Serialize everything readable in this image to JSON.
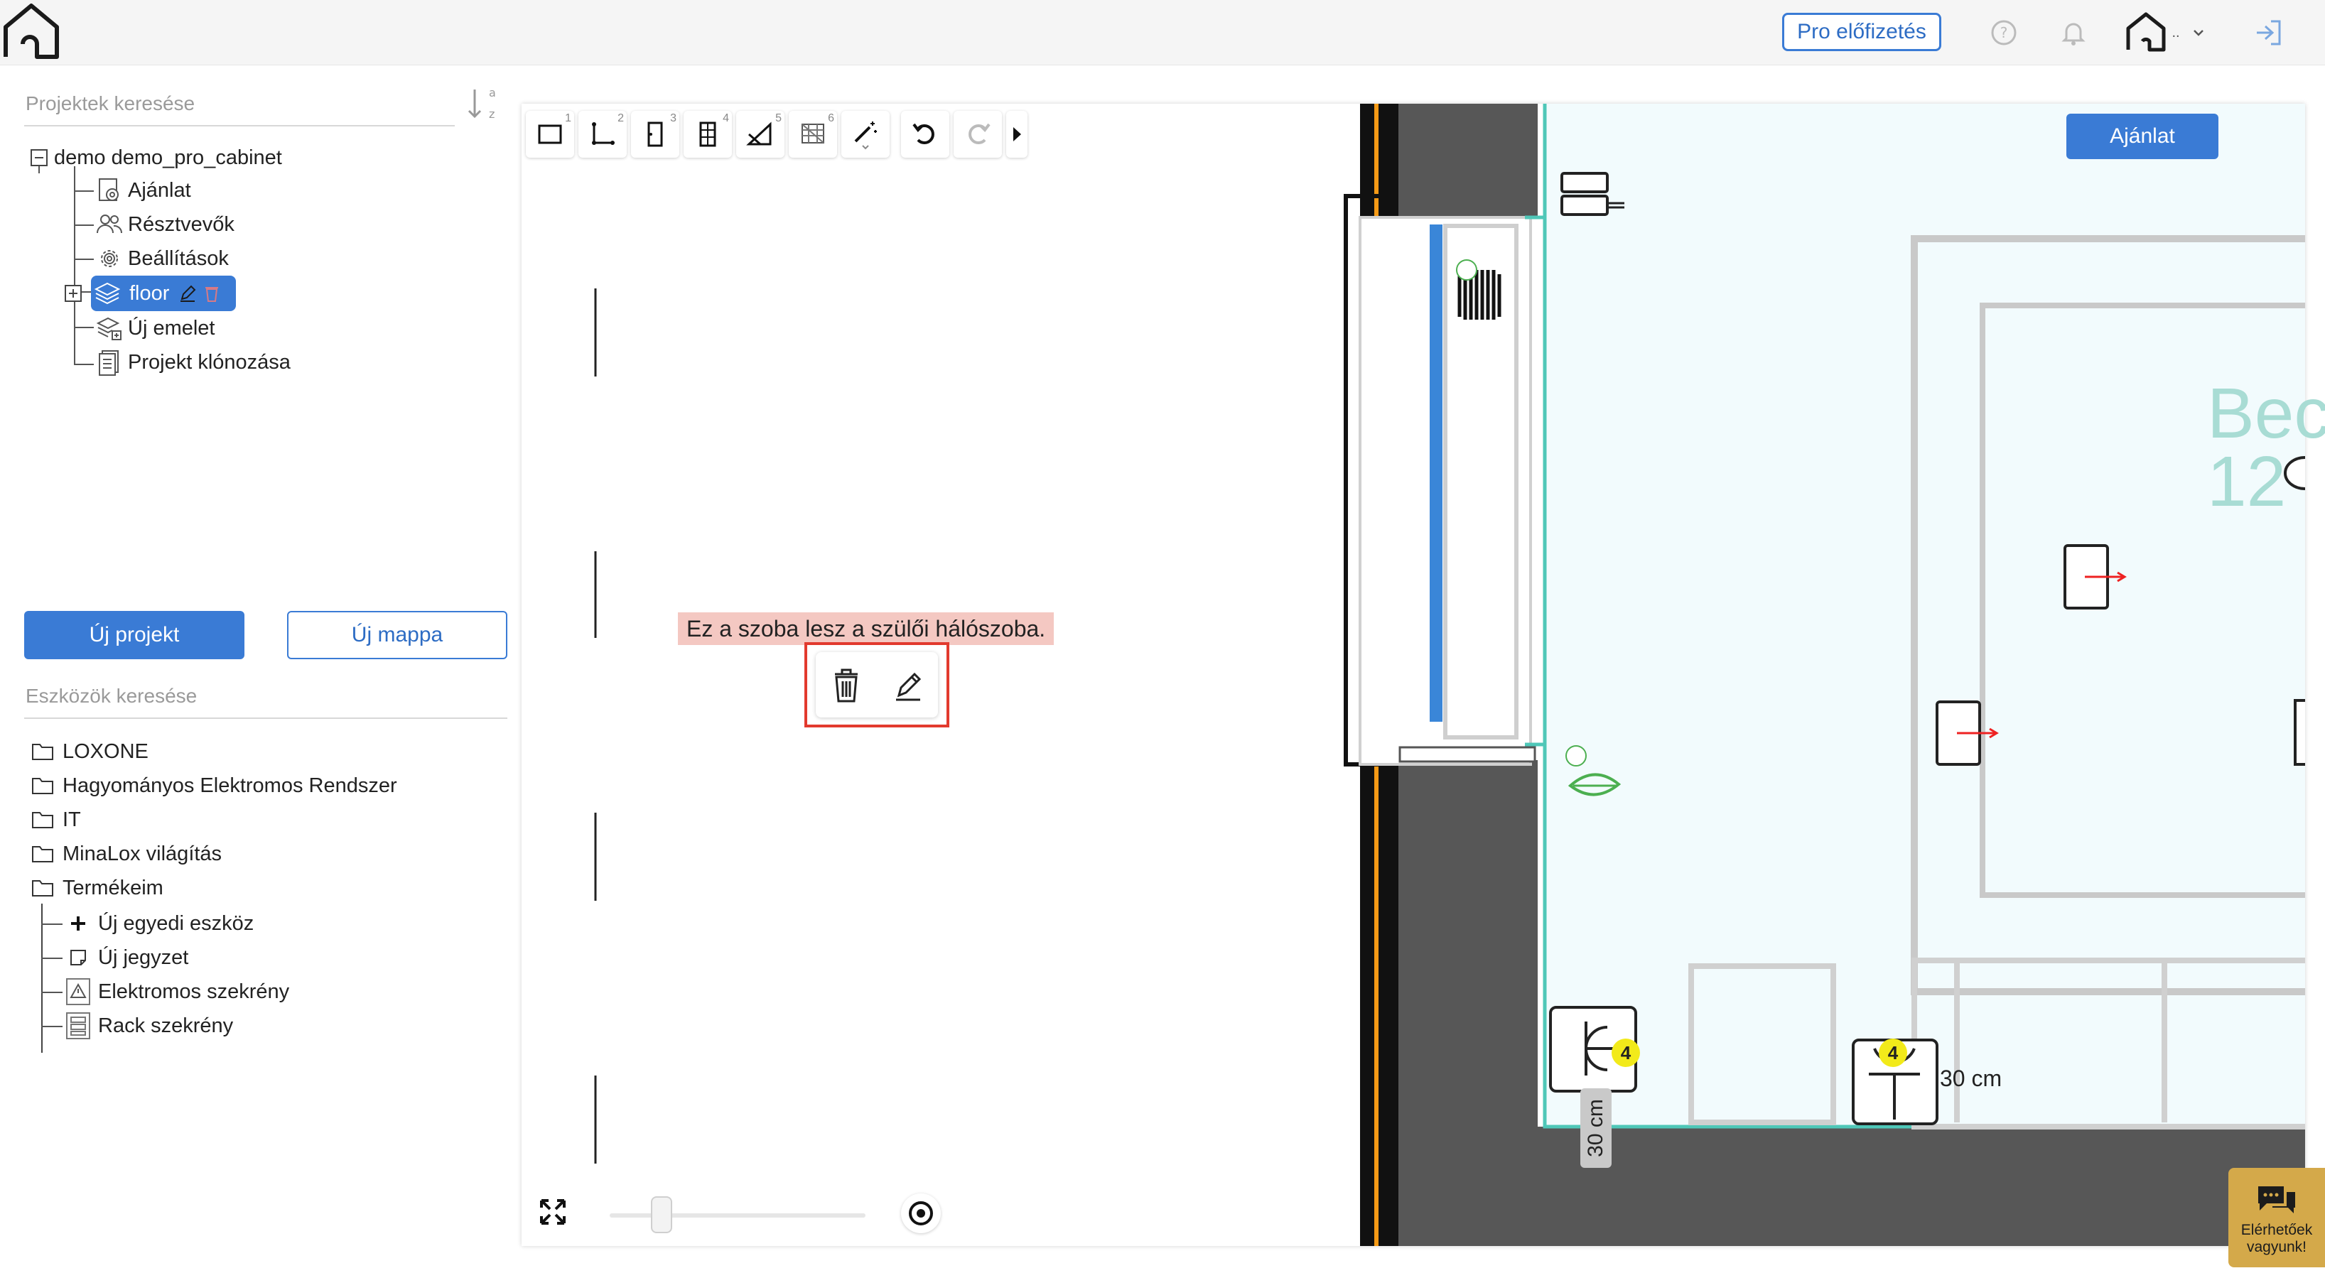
{
  "header": {
    "pro_label": "Pro előfizetés",
    "account_dots": "..",
    "icons": [
      "home-logo-icon",
      "help-icon",
      "bell-icon",
      "account-home-icon",
      "chevron-down-icon",
      "logout-icon"
    ]
  },
  "projects": {
    "search_placeholder": "Projektek keresése",
    "sort_top": "a",
    "sort_bottom": "z",
    "tree": {
      "root": "demo demo_pro_cabinet",
      "items": [
        "Ajánlat",
        "Résztvevők",
        "Beállítások",
        "floor",
        "Új emelet",
        "Projekt klónozása"
      ]
    },
    "new_project": "Új projekt",
    "new_folder": "Új mappa"
  },
  "tools": {
    "search_placeholder": "Eszközök keresése",
    "folders": [
      "LOXONE",
      "Hagyományos Elektromos Rendszer",
      "IT",
      "MinaLox világítás",
      "Termékeim"
    ],
    "my_products": [
      "Új egyedi eszköz",
      "Új jegyzet",
      "Elektromos szekrény",
      "Rack szekrény"
    ]
  },
  "canvas": {
    "toolbar_numbers": [
      "1",
      "2",
      "3",
      "4",
      "5",
      "6"
    ],
    "offer_button": "Ajánlat",
    "note_text": "Ez a szoba lesz a szülői hálószoba.",
    "dim_vertical": "30 cm",
    "dim_horizontal": "30 cm",
    "badge_1": "4",
    "badge_2": "4",
    "room_label_line1": "Bec",
    "room_label_line2": "12",
    "zoom_level": 0.2,
    "accent_color": "#3a7bd5",
    "wall_color": "#575757",
    "room_outline_color": "#4fc7b8"
  },
  "chat": {
    "label_line1": "Elérhetőek",
    "label_line2": "vagyunk!"
  }
}
